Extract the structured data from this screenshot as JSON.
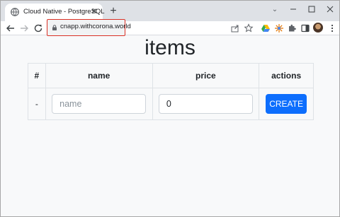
{
  "browser": {
    "tab": {
      "title": "Cloud Native - PostgreSQL",
      "close_glyph": "✕"
    },
    "new_tab_glyph": "+",
    "tab_search_glyph": "⌄",
    "url": "cnapp.withcorona.world"
  },
  "page": {
    "title": "items",
    "table": {
      "headers": [
        "#",
        "name",
        "price",
        "actions"
      ],
      "new_row": {
        "id": "-",
        "name_placeholder": "name",
        "price_value": "0",
        "create_label": "CREATE"
      }
    }
  },
  "colors": {
    "create_button": "#0d6efd",
    "url_highlight_border": "#d93025"
  }
}
